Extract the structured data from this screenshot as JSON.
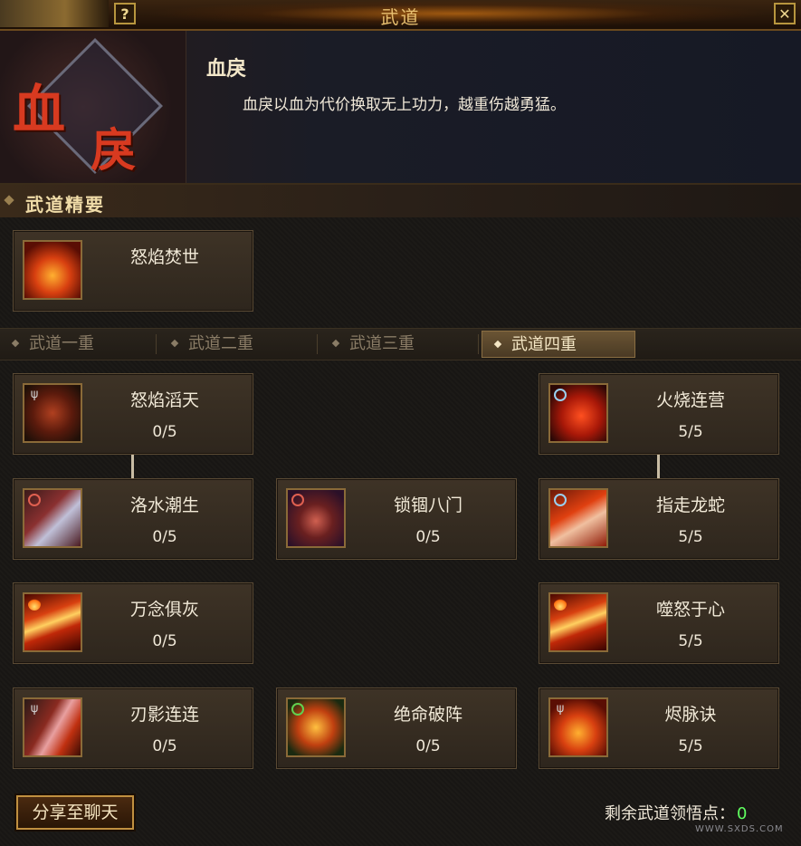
{
  "window": {
    "title": "武道",
    "help_label": "?",
    "close_label": "✕"
  },
  "header": {
    "emblem_text_1": "血",
    "emblem_text_2": "戾",
    "style_name": "血戾",
    "style_desc": "血戾以血为代价换取无上功力，越重伤越勇猛。"
  },
  "section": {
    "title": "武道精要"
  },
  "essence_skill": {
    "name": "怒焰焚世",
    "icon": "rage-fire-figure-icon"
  },
  "tabs": [
    {
      "label": "武道一重",
      "active": false
    },
    {
      "label": "武道二重",
      "active": false
    },
    {
      "label": "武道三重",
      "active": false
    },
    {
      "label": "武道四重",
      "active": true
    }
  ],
  "skills": [
    {
      "name": "怒焰滔天",
      "level": "0/5",
      "icon": "rage-flame-icon"
    },
    {
      "name": "火烧连营",
      "level": "5/5",
      "icon": "fire-burn-icon"
    },
    {
      "name": "洛水潮生",
      "level": "0/5",
      "icon": "water-tide-icon"
    },
    {
      "name": "锁锢八门",
      "level": "0/5",
      "icon": "skull-lock-icon"
    },
    {
      "name": "指走龙蛇",
      "level": "5/5",
      "icon": "dragon-hand-icon"
    },
    {
      "name": "万念俱灰",
      "level": "0/5",
      "icon": "ash-flame-icon"
    },
    {
      "name": "噬怒于心",
      "level": "5/5",
      "icon": "devour-rage-icon"
    },
    {
      "name": "刃影连连",
      "level": "0/5",
      "icon": "blade-shadow-icon"
    },
    {
      "name": "绝命破阵",
      "level": "0/5",
      "icon": "break-formation-icon"
    },
    {
      "name": "烬脉诀",
      "level": "5/5",
      "icon": "ember-vein-icon"
    }
  ],
  "footer": {
    "share_label": "分享至聊天",
    "points_label": "剩余武道领悟点：",
    "points_value": "0",
    "watermark": "WWW.SXDS.COM"
  }
}
